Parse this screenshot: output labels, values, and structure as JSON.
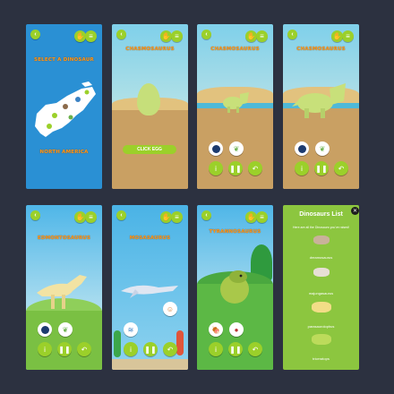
{
  "screens": {
    "select": {
      "title": "SELECT A DINOSAUR",
      "region": "NORTH AMERICA"
    },
    "egg": {
      "title": "CHASMOSAURUS",
      "button": "CLICK EGG"
    },
    "chasmo_small": {
      "title": "CHASMOSAURUS"
    },
    "chasmo_big": {
      "title": "CHASMOSAURUS"
    },
    "edmonto": {
      "title": "EDMONTOSAURUS"
    },
    "mosa": {
      "title": "MOSASAURUS"
    },
    "tyranno": {
      "title": "TYRANNOSAURUS"
    },
    "list": {
      "title": "Dinosaurs List",
      "subtitle": "Here are all the Dinosaurs you've raised!",
      "items": [
        "dreamosaurus",
        "majungasaurus",
        "parasaurolophus",
        "triceratops"
      ]
    }
  },
  "icons": {
    "back": "back-arrow-icon",
    "hand": "hand-icon",
    "menu": "menu-icon",
    "info": "info-icon",
    "pause": "pause-icon",
    "undo": "undo-icon",
    "close": "close-icon"
  },
  "colors": {
    "background": "#2c3140",
    "accent_green": "#9bd02a",
    "title_orange": "#ff9a1e",
    "list_green": "#8cc63f"
  }
}
